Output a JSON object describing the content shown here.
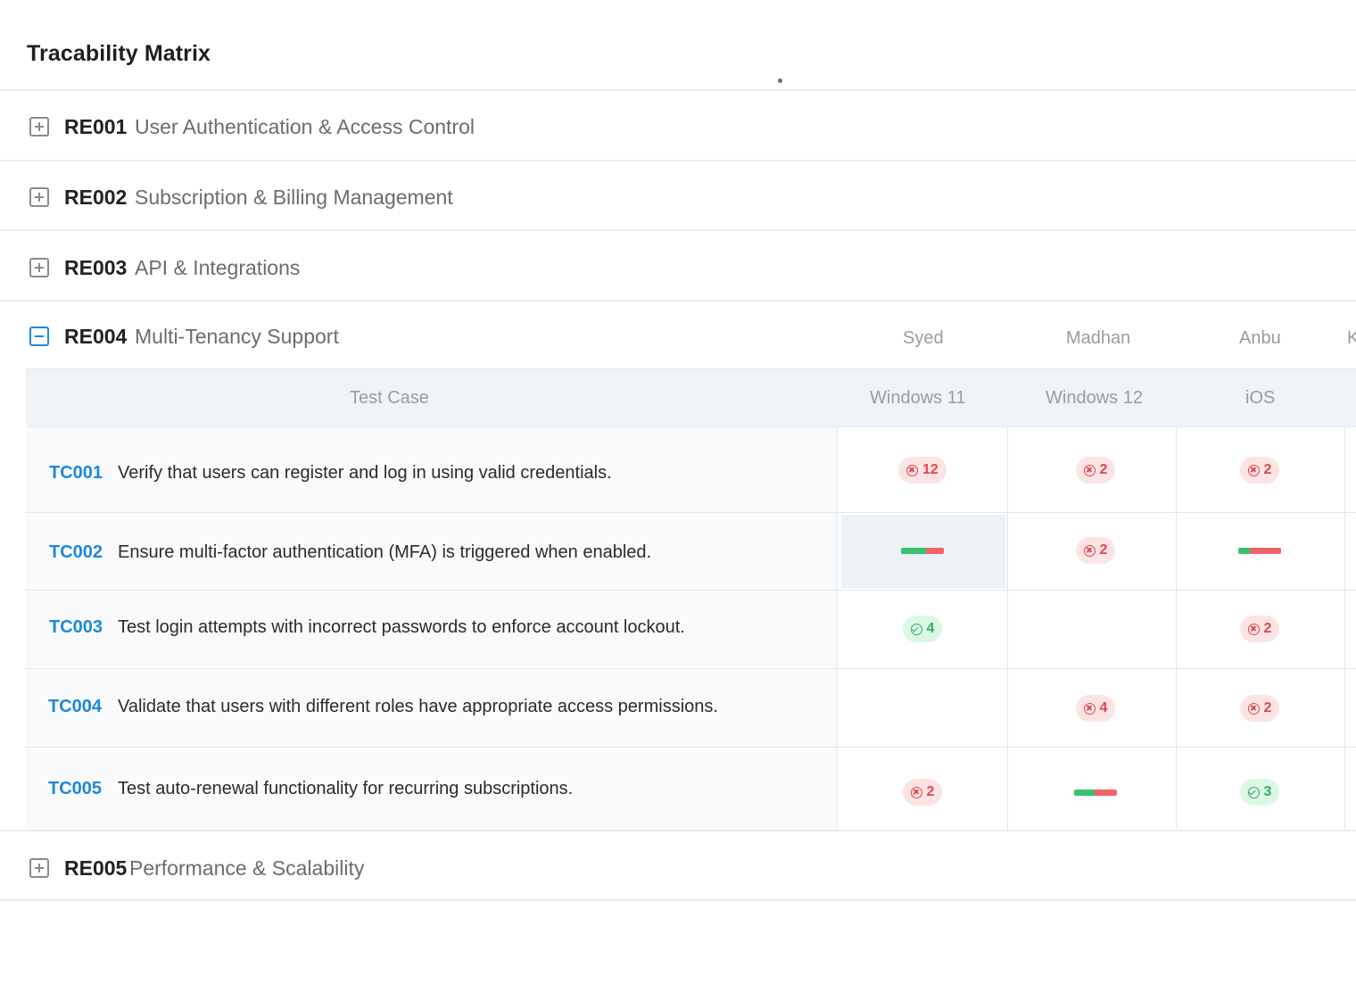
{
  "page": {
    "title": "Tracability Matrix"
  },
  "colors": {
    "accent": "#1e88d9",
    "fail": "#e0454b",
    "pass": "#2fae5f",
    "toggle": "#8a8a8a"
  },
  "requirements": [
    {
      "code": "RE001",
      "name": "User Authentication & Access Control",
      "expanded": false
    },
    {
      "code": "RE002",
      "name": "Subscription & Billing Management",
      "expanded": false
    },
    {
      "code": "RE003",
      "name": "API & Integrations",
      "expanded": false
    },
    {
      "code": "RE004",
      "name": "Multi-Tenancy Support",
      "expanded": true
    },
    {
      "code": "RE005",
      "name": "Performance & Scalability",
      "expanded": false
    }
  ],
  "matrix": {
    "test_case_header": "Test Case",
    "assignees": [
      "Syed",
      "Madhan",
      "Anbu",
      "K"
    ],
    "platforms": [
      "Windows 11",
      "Windows 12",
      "iOS"
    ],
    "test_cases": [
      {
        "id": "TC001",
        "description": "Verify that users can register and log in using valid credentials.",
        "results": [
          {
            "type": "fail",
            "count": "12"
          },
          {
            "type": "fail",
            "count": "2"
          },
          {
            "type": "fail",
            "count": "2"
          }
        ]
      },
      {
        "id": "TC002",
        "description": "Ensure multi-factor authentication (MFA) is triggered when enabled.",
        "results": [
          {
            "type": "progress",
            "pass_fraction": 0.58
          },
          {
            "type": "fail",
            "count": "2"
          },
          {
            "type": "progress",
            "pass_fraction": 0.27
          }
        ]
      },
      {
        "id": "TC003",
        "description": "Test login attempts with incorrect passwords to enforce account lockout.",
        "results": [
          {
            "type": "pass",
            "count": "4"
          },
          {
            "type": "empty"
          },
          {
            "type": "fail",
            "count": "2"
          }
        ]
      },
      {
        "id": "TC004",
        "description": "Validate that users with different roles have appropriate access permissions.",
        "results": [
          {
            "type": "empty"
          },
          {
            "type": "fail",
            "count": "4"
          },
          {
            "type": "fail",
            "count": "2"
          }
        ]
      },
      {
        "id": "TC005",
        "description": "Test auto-renewal functionality for recurring subscriptions.",
        "results": [
          {
            "type": "fail",
            "count": "2"
          },
          {
            "type": "progress",
            "pass_fraction": 0.48
          },
          {
            "type": "pass",
            "count": "3"
          }
        ]
      }
    ]
  }
}
